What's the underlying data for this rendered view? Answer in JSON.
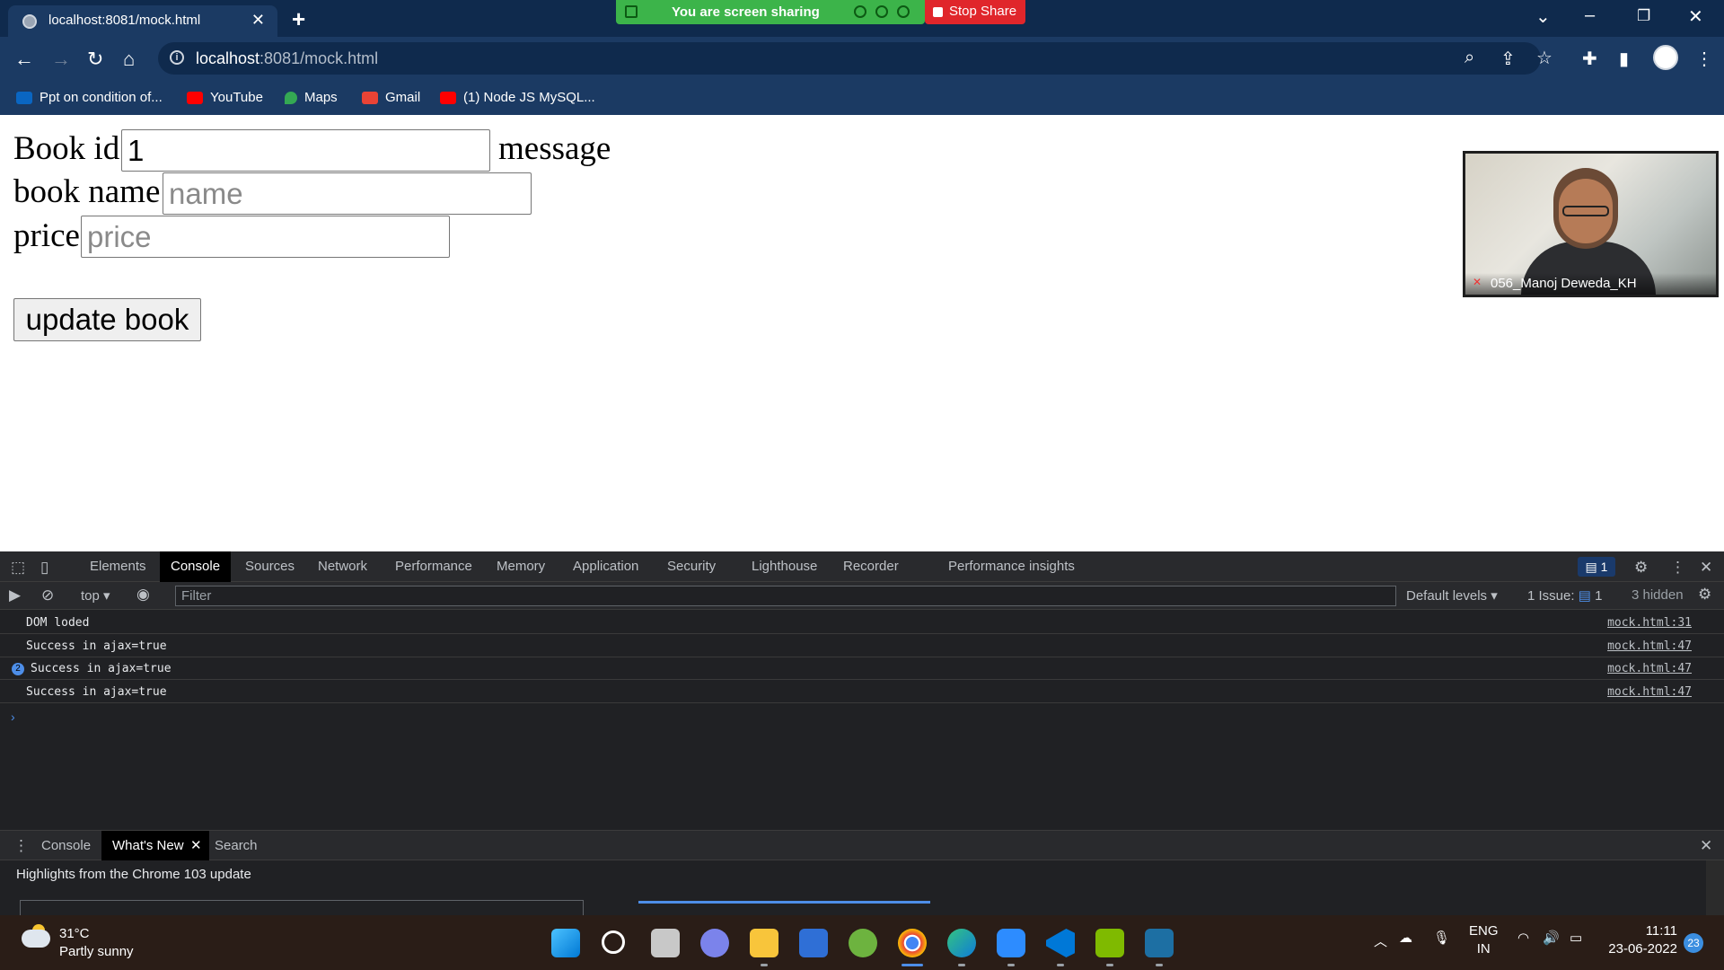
{
  "browser": {
    "tab_title": "localhost:8081/mock.html",
    "tab_close": "✕",
    "new_tab": "+",
    "url_host": "localhost",
    "url_rest": ":8081/mock.html"
  },
  "screen_share": {
    "banner_text": "You are screen sharing",
    "stop_label": "Stop Share"
  },
  "bookmarks": [
    {
      "label": "Ppt on condition of...",
      "color": "#0a66c2"
    },
    {
      "label": "YouTube",
      "color": "#ff0000"
    },
    {
      "label": "Maps",
      "color": "#34a853"
    },
    {
      "label": "Gmail",
      "color": "#ea4335"
    },
    {
      "label": "(1) Node JS MySQL...",
      "color": "#ff0000"
    }
  ],
  "page": {
    "book_id_label": "Book id",
    "book_id_value": "1",
    "message_label": "message",
    "book_name_label": "book name",
    "book_name_placeholder": "name",
    "price_label": "price",
    "price_placeholder": "price",
    "update_button": "update book"
  },
  "video": {
    "participant_name": "056_Manoj Deweda_KH"
  },
  "devtools": {
    "tabs": [
      "Elements",
      "Console",
      "Sources",
      "Network",
      "Performance",
      "Memory",
      "Application",
      "Security",
      "Lighthouse",
      "Recorder",
      "Performance insights"
    ],
    "active_tab": "Console",
    "message_badge": "1",
    "context": "top",
    "filter_placeholder": "Filter",
    "levels": "Default levels",
    "issues_label": "1 Issue:",
    "issues_count": "1",
    "hidden": "3 hidden",
    "console_lines": [
      {
        "text": "DOM loded",
        "source": "mock.html:31",
        "count": ""
      },
      {
        "text": "Success in ajax=true",
        "source": "mock.html:47",
        "count": ""
      },
      {
        "text": "Success in ajax=true",
        "source": "mock.html:47",
        "count": "2"
      },
      {
        "text": "Success in ajax=true",
        "source": "mock.html:47",
        "count": ""
      }
    ],
    "drawer_tabs": [
      "Console",
      "What's New",
      "Search"
    ],
    "drawer_active": "What's New",
    "drawer_heading": "Highlights from the Chrome 103 update"
  },
  "taskbar": {
    "temperature": "31°C",
    "weather": "Partly sunny",
    "lang_top": "ENG",
    "lang_bottom": "IN",
    "time": "11:11",
    "date": "23-06-2022",
    "notifications": "23"
  }
}
